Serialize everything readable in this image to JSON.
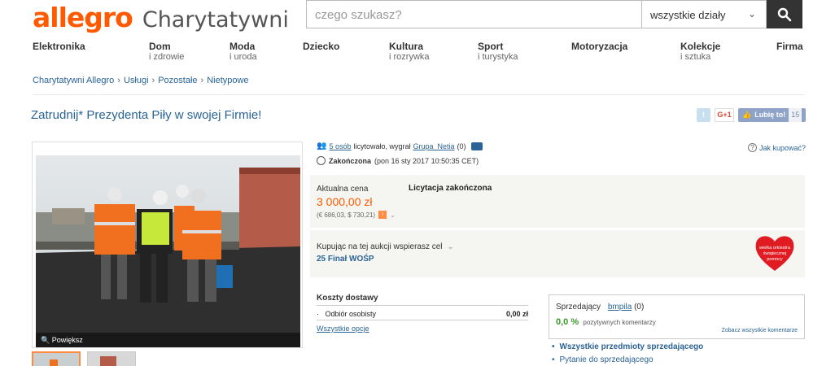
{
  "header": {
    "brand": "allegro",
    "sub_brand": "Charytatywni",
    "search_placeholder": "czego szukasz?",
    "category_select": "wszystkie działy"
  },
  "categories": [
    {
      "title": "Elektronika",
      "sub": ""
    },
    {
      "title": "Dom",
      "sub": "i zdrowie"
    },
    {
      "title": "Moda",
      "sub": "i uroda"
    },
    {
      "title": "Dziecko",
      "sub": ""
    },
    {
      "title": "Kultura",
      "sub": "i rozrywka"
    },
    {
      "title": "Sport",
      "sub": "i turystyka"
    },
    {
      "title": "Motoryzacja",
      "sub": ""
    },
    {
      "title": "Kolekcje",
      "sub": "i sztuka"
    },
    {
      "title": "Firma",
      "sub": ""
    }
  ],
  "breadcrumb": [
    "Charytatywni Allegro",
    "Usługi",
    "Pozostałe",
    "Nietypowe"
  ],
  "breadcrumb_sep": "›",
  "offer": {
    "title": "Zatrudnij* Prezydenta Piły w swojej Firmie!",
    "bidders_link": "5 osób",
    "bidders_text": "licytowało, wygrał",
    "winner": "Grupa_Netia",
    "winner_score": "(0)",
    "status_label": "Zakończona",
    "status_date": "(pon 16 sty 2017 10:50:35 CET)",
    "how_to_buy": "Jak kupować?",
    "photo_zoom": "Powiększ"
  },
  "social": {
    "twitter": "t",
    "gplus": "G+1",
    "fb_like": "Lubię to!",
    "fb_count": "15"
  },
  "price": {
    "label": "Aktualna cena",
    "value": "3 000,00 zł",
    "foreign": "(€ 686,03, $ 730,21)",
    "auction_state": "Licytacja zakończona"
  },
  "charity": {
    "support_text": "Kupując na tej aukcji wspierasz cel",
    "cause": "25 Finał WOŚP",
    "heart_text": "wielka orkiestra świątecznej pomocy"
  },
  "shipping": {
    "heading": "Koszty dostawy",
    "rows": [
      {
        "name": "Odbiór osobisty",
        "price": "0,00 zł"
      }
    ],
    "all_options": "Wszystkie opcje"
  },
  "seller": {
    "label": "Sprzedający",
    "name": "bmpila",
    "score": "(0)",
    "positive_pct": "0,0 %",
    "positive_text": "pozytywnych komentarzy",
    "all_comments": "Zobacz wszystkie komentarze",
    "link_items": "Wszystkie przedmioty sprzedającego",
    "link_question": "Pytanie do sprzedającego"
  },
  "colors": {
    "brand_orange": "#ff5a00",
    "link_blue": "#2a6496",
    "positive_green": "#3a9a2a"
  }
}
